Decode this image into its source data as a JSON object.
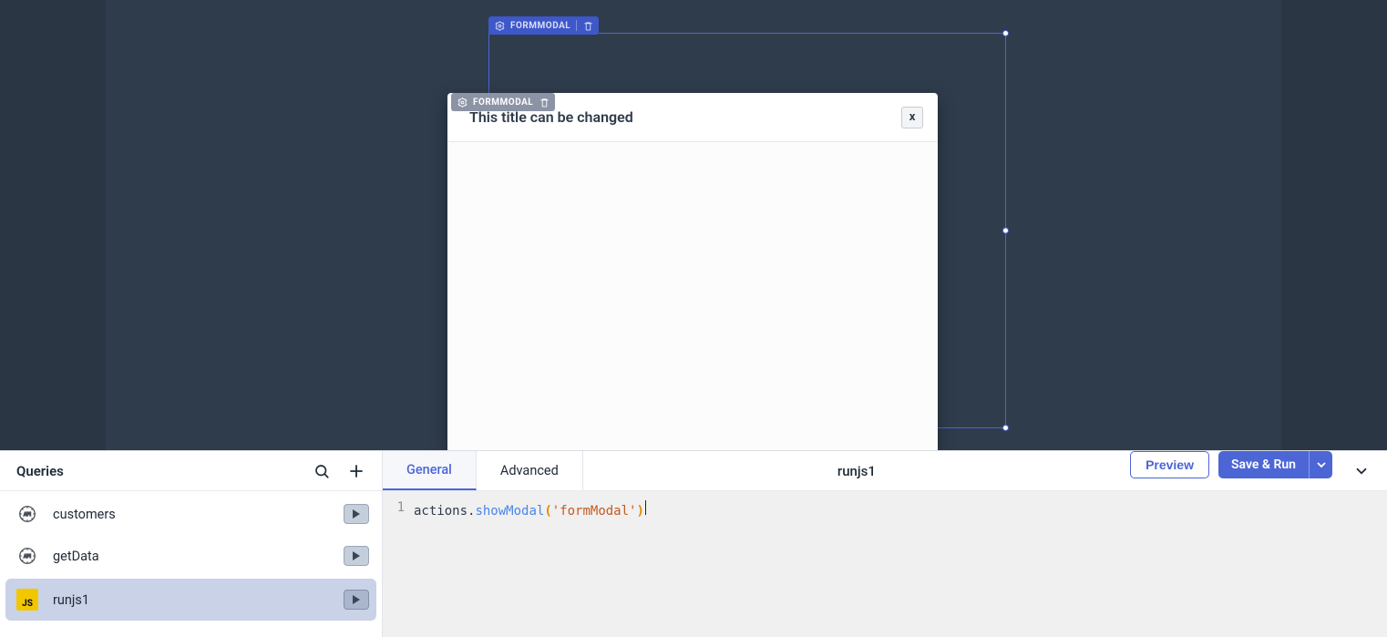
{
  "canvas": {
    "outer_tag_label": "FORMMODAL",
    "inner_tag_label": "FORMMODAL"
  },
  "modal": {
    "title": "This title can be changed",
    "close_label": "x"
  },
  "queries": {
    "header_title": "Queries",
    "items": [
      {
        "name": "customers",
        "kind": "api"
      },
      {
        "name": "getData",
        "kind": "api"
      },
      {
        "name": "runjs1",
        "kind": "js"
      }
    ],
    "active_index": 2
  },
  "editor": {
    "tabs": [
      {
        "label": "General",
        "active": true
      },
      {
        "label": "Advanced",
        "active": false
      }
    ],
    "current_query_name": "runjs1",
    "preview_label": "Preview",
    "save_run_label": "Save & Run",
    "code": {
      "line_no": "1",
      "obj": "actions",
      "dot": ".",
      "method": "showModal",
      "open": "(",
      "arg": "'formModal'",
      "close": ")"
    }
  },
  "icons": {
    "js_badge": "JS"
  }
}
